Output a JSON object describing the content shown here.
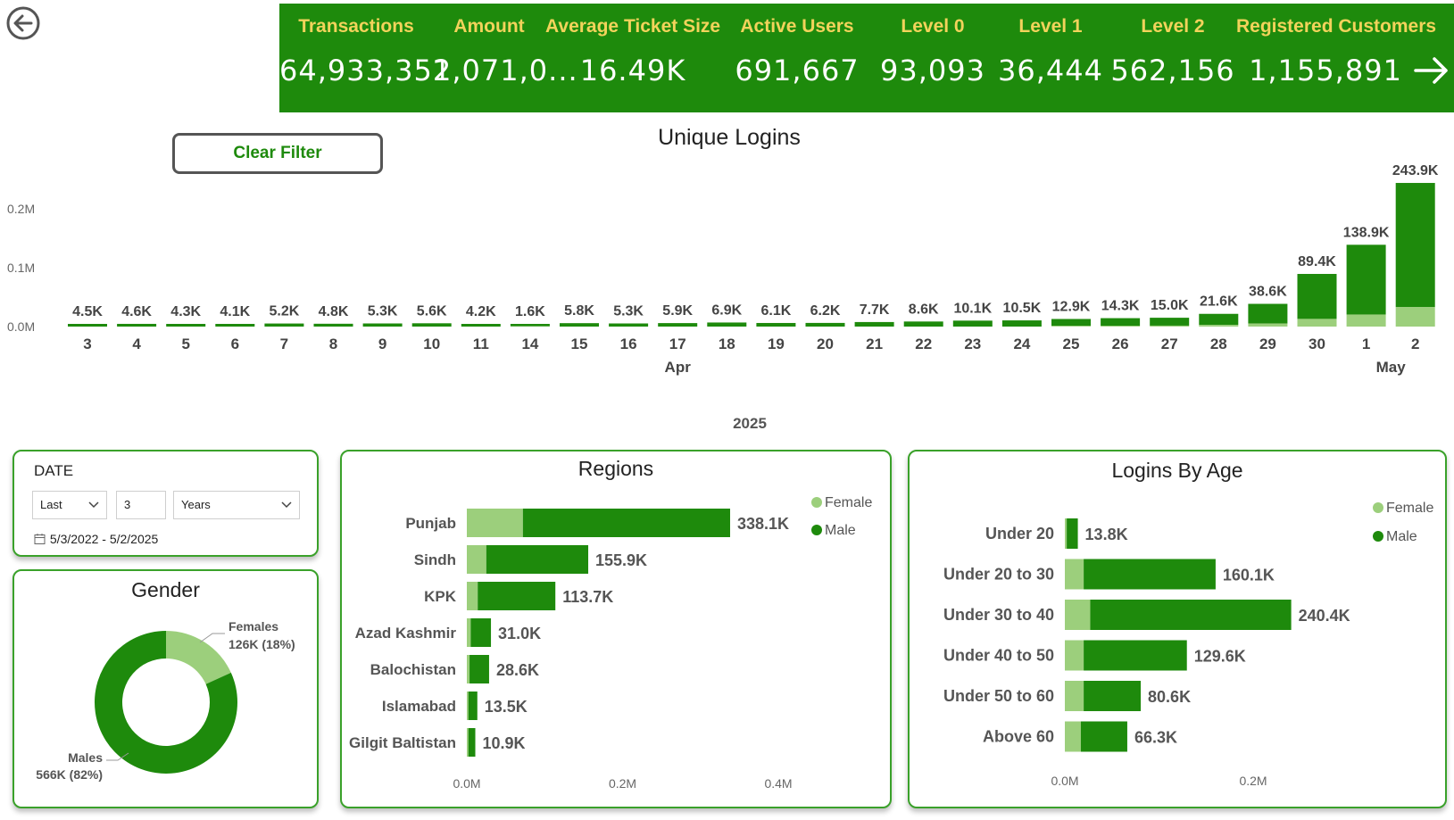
{
  "kpis": [
    {
      "label": "Transactions",
      "value": "64,933,352"
    },
    {
      "label": "Amount",
      "value": "1,071,0..."
    },
    {
      "label": "Average Ticket Size",
      "value": "16.49K"
    },
    {
      "label": "Active Users",
      "value": "691,667"
    },
    {
      "label": "Level 0",
      "value": "93,093"
    },
    {
      "label": "Level 1",
      "value": "36,444"
    },
    {
      "label": "Level 2",
      "value": "562,156"
    },
    {
      "label": "Registered Customers",
      "value": "1,155,891"
    }
  ],
  "clear_filter_label": "Clear Filter",
  "date_filter": {
    "label": "DATE",
    "relative": "Last",
    "count": "3",
    "unit": "Years",
    "range": "5/3/2022 - 5/2/2025"
  },
  "colors": {
    "primary": "#1e8a0c",
    "light": "#9ccf7c",
    "kpi_label": "#f2d35b"
  },
  "chart_data": [
    {
      "type": "bar",
      "title": "Unique Logins",
      "stacked": true,
      "categories": [
        "3",
        "4",
        "5",
        "6",
        "7",
        "8",
        "9",
        "10",
        "11",
        "14",
        "15",
        "16",
        "17",
        "18",
        "19",
        "20",
        "21",
        "22",
        "23",
        "24",
        "25",
        "26",
        "27",
        "28",
        "29",
        "30",
        "1",
        "2"
      ],
      "month_labels": [
        {
          "label": "Apr",
          "index": 12
        },
        {
          "label": "May",
          "index": 26.5
        }
      ],
      "year_label": "2025",
      "values": [
        4500,
        4600,
        4300,
        4100,
        5200,
        4800,
        5300,
        5600,
        4200,
        1600,
        5800,
        5300,
        5900,
        6900,
        6100,
        6200,
        7700,
        8600,
        10100,
        10500,
        12900,
        14300,
        15000,
        21600,
        38600,
        89400,
        138900,
        243900
      ],
      "value_labels": [
        "4.5K",
        "4.6K",
        "4.3K",
        "4.1K",
        "5.2K",
        "4.8K",
        "5.3K",
        "5.6K",
        "4.2K",
        "1.6K",
        "5.8K",
        "5.3K",
        "5.9K",
        "6.9K",
        "6.1K",
        "6.2K",
        "7.7K",
        "8.6K",
        "10.1K",
        "10.5K",
        "12.9K",
        "14.3K",
        "15.0K",
        "21.6K",
        "38.6K",
        "89.4K",
        "138.9K",
        "243.9K"
      ],
      "female_values": [
        0,
        0,
        0,
        0,
        0,
        0,
        0,
        0,
        0,
        400,
        0,
        0,
        0,
        0,
        0,
        0,
        0,
        0,
        0,
        0,
        1300,
        1500,
        1600,
        2800,
        5200,
        13000,
        20500,
        33000
      ],
      "yticks": [
        {
          "value": 0,
          "label": "0.0M"
        },
        {
          "value": 100000,
          "label": "0.1M"
        },
        {
          "value": 200000,
          "label": "0.2M"
        }
      ],
      "ylim": [
        0,
        250000
      ],
      "grid": false
    },
    {
      "type": "bar",
      "orientation": "horizontal",
      "title": "Regions",
      "categories": [
        "Punjab",
        "Sindh",
        "KPK",
        "Azad Kashmir",
        "Balochistan",
        "Islamabad",
        "Gilgit Baltistan"
      ],
      "series": [
        {
          "name": "Female",
          "values": [
            72000,
            25000,
            14000,
            5000,
            3500,
            2000,
            2000
          ]
        },
        {
          "name": "Male",
          "values": [
            266100,
            130900,
            99700,
            26000,
            25100,
            11500,
            8900
          ]
        }
      ],
      "total_labels": [
        "338.1K",
        "155.9K",
        "113.7K",
        "31.0K",
        "28.6K",
        "13.5K",
        "10.9K"
      ],
      "xticks": [
        {
          "value": 0,
          "label": "0.0M"
        },
        {
          "value": 200000,
          "label": "0.2M"
        },
        {
          "value": 400000,
          "label": "0.4M"
        }
      ],
      "xlim": [
        0,
        400000
      ],
      "legend": "top-right"
    },
    {
      "type": "bar",
      "orientation": "horizontal",
      "title": "Logins By Age",
      "categories": [
        "Under 20",
        "Under 20 to 30",
        "Under 30 to 40",
        "Under 40 to 50",
        "Under 50 to 60",
        "Above 60"
      ],
      "series": [
        {
          "name": "Female",
          "values": [
            2000,
            20000,
            27000,
            20000,
            20000,
            17000
          ]
        },
        {
          "name": "Male",
          "values": [
            11800,
            140100,
            213400,
            109600,
            60600,
            49300
          ]
        }
      ],
      "total_labels": [
        "13.8K",
        "160.1K",
        "240.4K",
        "129.6K",
        "80.6K",
        "66.3K"
      ],
      "xticks": [
        {
          "value": 0,
          "label": "0.0M"
        },
        {
          "value": 200000,
          "label": "0.2M"
        }
      ],
      "xlim": [
        0,
        200000
      ],
      "legend": "top-right"
    },
    {
      "type": "pie",
      "donut": true,
      "title": "Gender",
      "slices": [
        {
          "name": "Females",
          "value": 126000,
          "label": "126K (18%)"
        },
        {
          "name": "Males",
          "value": 566000,
          "label": "566K (82%)"
        }
      ]
    }
  ]
}
